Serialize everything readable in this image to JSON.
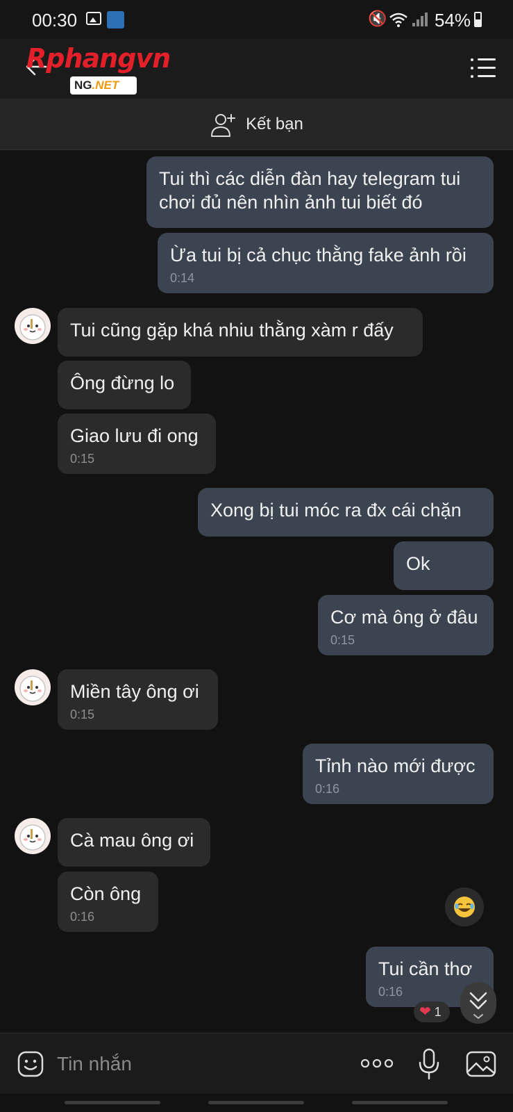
{
  "status_bar": {
    "time": "00:30",
    "battery": "54%"
  },
  "header": {
    "logo_main": "Rphangvn",
    "logo_sub_left": "NG",
    "logo_sub_right": ".NET"
  },
  "friend_bar": {
    "add_friend_label": "Kết bạn"
  },
  "messages": [
    {
      "dir": "out",
      "text": "Tui thì các diễn đàn hay telegram tui\nchơi đủ nên nhìn ảnh tui biết đó",
      "time": ""
    },
    {
      "dir": "out",
      "text": "Ừa tui bị cả chục thằng fake ảnh rồi",
      "time": "0:14"
    },
    {
      "dir": "in",
      "text": "Tui cũng gặp khá nhiu thằng xàm r đấy",
      "time": ""
    },
    {
      "dir": "in",
      "text": "Ông đừng lo",
      "time": ""
    },
    {
      "dir": "in",
      "text": "Giao lưu đi ong",
      "time": "0:15"
    },
    {
      "dir": "out",
      "text": "Xong bị tui móc ra đx cái chặn",
      "time": ""
    },
    {
      "dir": "out",
      "text": "Ok",
      "time": ""
    },
    {
      "dir": "out",
      "text": "Cơ mà ông ở đâu",
      "time": "0:15"
    },
    {
      "dir": "in",
      "text": "Miền tây ông ơi",
      "time": "0:15"
    },
    {
      "dir": "out",
      "text": "Tỉnh nào mới được",
      "time": "0:16"
    },
    {
      "dir": "in",
      "text": "Cà mau ông ơi",
      "time": ""
    },
    {
      "dir": "in",
      "text": "Còn ông",
      "time": "0:16"
    },
    {
      "dir": "out",
      "text": "Tui cần thơ",
      "time": "0:16"
    }
  ],
  "reaction": {
    "count": "1"
  },
  "input": {
    "placeholder": "Tin nhắn"
  },
  "colors": {
    "outgoing_bubble": "#3b4450",
    "incoming_bubble": "#2b2b2b",
    "background": "#121212"
  }
}
